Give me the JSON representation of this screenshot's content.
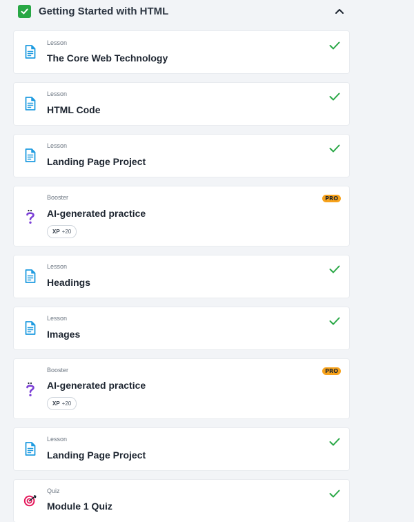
{
  "module": {
    "title": "Getting Started with HTML",
    "completed": true,
    "expanded": true
  },
  "colors": {
    "check_green": "#28a745",
    "lesson_icon_blue": "#1e9be0",
    "booster_icon_purple": "#7b3fd6",
    "quiz_icon_red": "#e5185b",
    "pro_badge": "#f7a21b"
  },
  "items": [
    {
      "type": "Lesson",
      "title": "The Core Web Technology",
      "icon": "lesson-document-icon",
      "status": "completed"
    },
    {
      "type": "Lesson",
      "title": "HTML Code",
      "icon": "lesson-document-icon",
      "status": "completed"
    },
    {
      "type": "Lesson",
      "title": "Landing Page Project",
      "icon": "lesson-document-icon",
      "status": "completed"
    },
    {
      "type": "Booster",
      "title": "AI-generated practice",
      "icon": "booster-question-icon",
      "status": "pro",
      "badge": "PRO",
      "xp_label": "XP",
      "xp_value": "+20"
    },
    {
      "type": "Lesson",
      "title": "Headings",
      "icon": "lesson-document-icon",
      "status": "completed"
    },
    {
      "type": "Lesson",
      "title": "Images",
      "icon": "lesson-document-icon",
      "status": "completed"
    },
    {
      "type": "Booster",
      "title": "AI-generated practice",
      "icon": "booster-question-icon",
      "status": "pro",
      "badge": "PRO",
      "xp_label": "XP",
      "xp_value": "+20"
    },
    {
      "type": "Lesson",
      "title": "Landing Page Project",
      "icon": "lesson-document-icon",
      "status": "completed"
    },
    {
      "type": "Quiz",
      "title": "Module 1 Quiz",
      "icon": "quiz-target-icon",
      "status": "completed"
    }
  ]
}
